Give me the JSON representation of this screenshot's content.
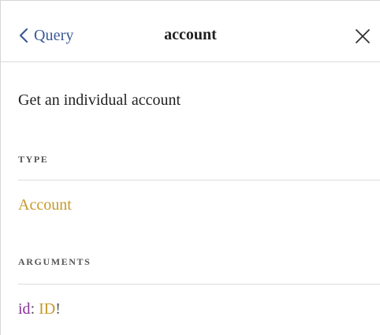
{
  "header": {
    "back_label": "Query",
    "title": "account",
    "back_icon": "chevron-left-icon",
    "close_icon": "close-icon"
  },
  "description": "Get an individual account",
  "type_section": {
    "title": "TYPE",
    "value": "Account"
  },
  "arguments_section": {
    "title": "ARGUMENTS",
    "items": [
      {
        "name": "id",
        "separator": ":",
        "type": "ID",
        "suffix": "!"
      }
    ]
  },
  "colors": {
    "link_blue": "#3b5998",
    "type_gold": "#c59a2a",
    "arg_purple": "#8b2f9c",
    "text_dark": "#1f1f1f",
    "section_gray": "#555555",
    "divider": "#dddddd"
  }
}
